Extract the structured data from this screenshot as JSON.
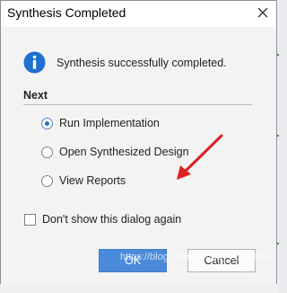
{
  "dialog": {
    "title": "Synthesis Completed",
    "message": "Synthesis successfully completed.",
    "section_label": "Next",
    "options": [
      {
        "label": "Run Implementation",
        "checked": true
      },
      {
        "label": "Open Synthesized Design",
        "checked": false
      },
      {
        "label": "View Reports",
        "checked": false
      }
    ],
    "dont_show_label": "Don't show this dialog again",
    "dont_show_checked": false,
    "ok_label": "OK",
    "cancel_label": "Cancel"
  },
  "icons": {
    "info": "info-icon",
    "close": "close-icon"
  },
  "colors": {
    "ok_button": "#4a8ad8",
    "info_icon": "#1e6fd0",
    "annotation_arrow": "#e02020"
  },
  "watermark": "https://blog.csdn.net/qq_41168852"
}
